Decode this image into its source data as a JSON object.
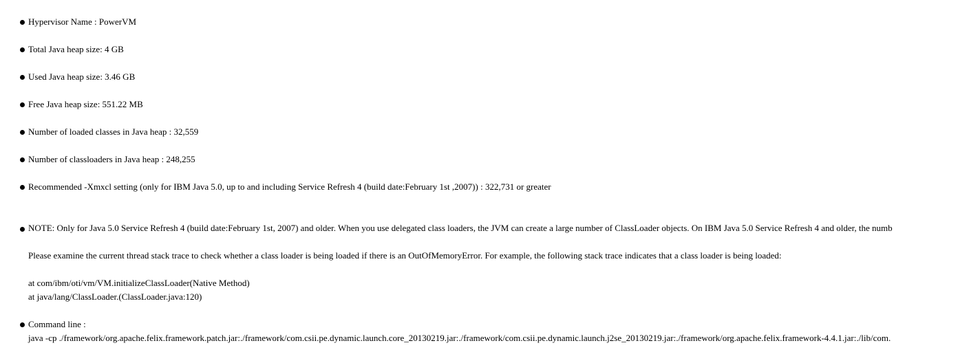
{
  "items": [
    {
      "text": "Hypervisor Name : PowerVM"
    },
    {
      "text": "Total Java heap size: 4 GB"
    },
    {
      "text": "Used Java heap size: 3.46 GB"
    },
    {
      "text": "Free Java heap size: 551.22 MB"
    },
    {
      "text": "Number of loaded classes in Java heap : 32,559"
    },
    {
      "text": "Number of classloaders in Java heap : 248,255"
    },
    {
      "text": "Recommended -Xmxcl setting (only for IBM Java 5.0, up to and including Service Refresh 4 (build date:February 1st ,2007)) : 322,731 or greater"
    }
  ],
  "note": {
    "text": "NOTE: Only for Java 5.0 Service Refresh 4 (build date:February 1st, 2007) and older. When you use delegated class loaders, the JVM can create a large number of ClassLoader objects. On IBM Java 5.0 Service Refresh 4 and older, the numb",
    "paragraph": "Please examine the current thread stack trace to check whether a class loader is being loaded if there is an OutOfMemoryError. For example, the following stack trace indicates that a class loader is being loaded:",
    "stack_line_1": "at com/ibm/oti/vm/VM.initializeClassLoader(Native Method)",
    "stack_line_2": "at java/lang/ClassLoader.(ClassLoader.java:120)"
  },
  "command": {
    "label": "Command line :",
    "value": "java -cp ./framework/org.apache.felix.framework.patch.jar:./framework/com.csii.pe.dynamic.launch.core_20130219.jar:./framework/com.csii.pe.dynamic.launch.j2se_20130219.jar:./framework/org.apache.felix.framework-4.4.1.jar:./lib/com."
  }
}
